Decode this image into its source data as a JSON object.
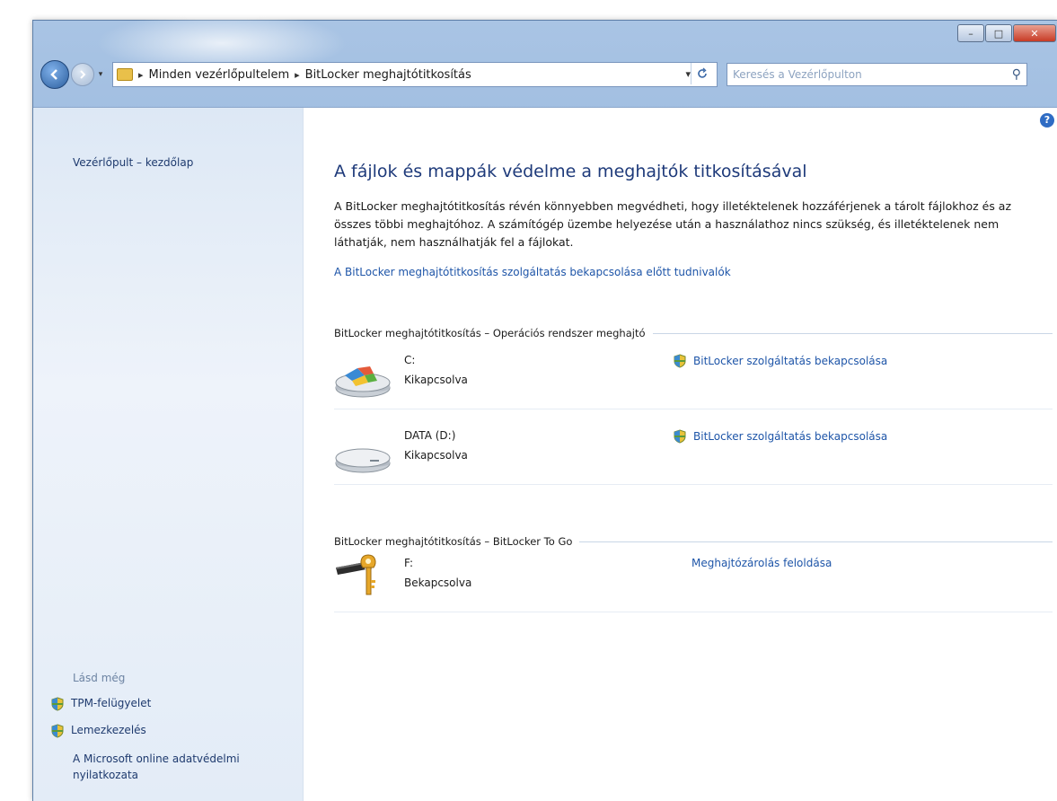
{
  "titlebar": {
    "buttons": {
      "minimize": "–",
      "maximize": "□",
      "close": "✕"
    }
  },
  "addressbar": {
    "crumbs": [
      "Minden vezérlőpultelem",
      "BitLocker meghajtótitkosítás"
    ],
    "search_placeholder": "Keresés a Vezérlőpulton"
  },
  "sidebar": {
    "home_link": "Vezérlőpult – kezdőlap",
    "see_also_heading": "Lásd még",
    "links": [
      {
        "label": "TPM-felügyelet",
        "icon": "shield-icon"
      },
      {
        "label": "Lemezkezelés",
        "icon": "shield-icon"
      }
    ],
    "ms_link": "A Microsoft online adatvédelmi nyilatkozata"
  },
  "main": {
    "title": "A fájlok és mappák védelme a meghajtók titkosításával",
    "description": "A BitLocker meghajtótitkosítás révén könnyebben megvédheti, hogy illetéktelenek hozzáférjenek a tárolt fájlokhoz és az összes többi meghajtóhoz. A számítógép üzembe helyezése után a használathoz nincs szükség, és illetéktelenek nem láthatják, nem használhatják fel a fájlokat.",
    "info_link": "A BitLocker meghajtótitkosítás szolgáltatás bekapcsolása előtt tudnivalók",
    "section_os": "BitLocker meghajtótitkosítás – Operációs rendszer meghajtó",
    "section_removable": "BitLocker meghajtótitkosítás – BitLocker To Go",
    "os_drives": [
      {
        "name": "C:",
        "status": "Kikapcsolva",
        "action": "BitLocker szolgáltatás bekapcsolása",
        "icon": "system-drive-icon"
      },
      {
        "name": "DATA (D:)",
        "status": "Kikapcsolva",
        "action": "BitLocker szolgáltatás bekapcsolása",
        "icon": "hard-drive-icon"
      }
    ],
    "removable_drives": [
      {
        "name": "F:",
        "status": "Bekapcsolva",
        "action": "Meghajtózárolás feloldása",
        "icon": "locked-usb-drive-icon"
      }
    ]
  },
  "colors": {
    "link": "#1e55a8",
    "title": "#1e3a7a",
    "aero_frame": "#8fb1db"
  }
}
